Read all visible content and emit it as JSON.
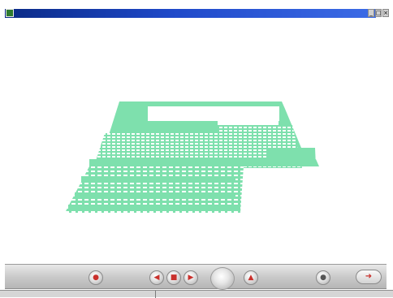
{
  "window": {
    "title": "",
    "buttons": [
      {
        "name": "minimize",
        "glyph": "_"
      },
      {
        "name": "maximize",
        "glyph": "□"
      },
      {
        "name": "close",
        "glyph": "×"
      }
    ]
  },
  "toolbar": {
    "buttons": [
      {
        "name": "record-button",
        "icon": "record-icon"
      },
      {
        "name": "rewind-button",
        "icon": "rewind-icon"
      },
      {
        "name": "play-button",
        "icon": "play-icon"
      },
      {
        "name": "forward-button",
        "icon": "forward-icon"
      },
      {
        "name": "zoom-dial",
        "icon": "dial-icon"
      },
      {
        "name": "eject-button",
        "icon": "eject-icon"
      },
      {
        "name": "info-button",
        "icon": "info-icon"
      },
      {
        "name": "exit-button",
        "icon": "exit-arrow-icon"
      }
    ]
  },
  "status": {
    "left": "",
    "middle": ""
  },
  "colors": {
    "title_bar": "#1f49c9",
    "object_fill": "#7ee0ad",
    "toolbar": "#c8c8c8",
    "accent": "#c9302c"
  }
}
